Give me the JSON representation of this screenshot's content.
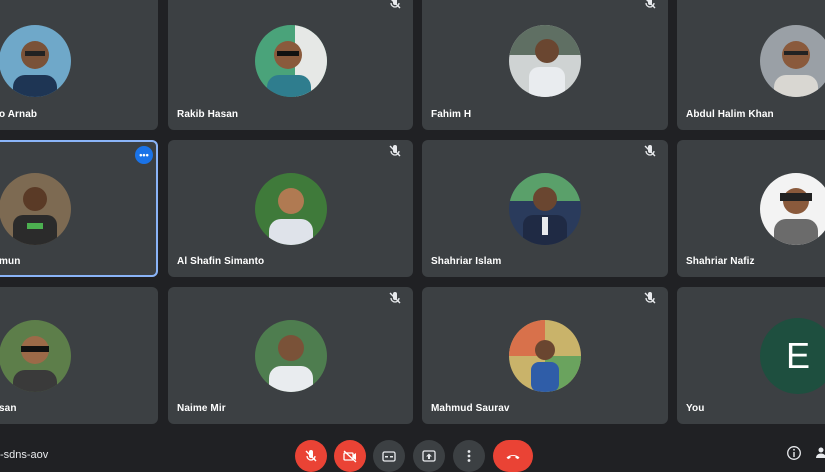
{
  "participants": {
    "row1": [
      {
        "name": "o Arnab",
        "muted": false
      },
      {
        "name": "Rakib Hasan",
        "muted": true
      },
      {
        "name": "Fahim H",
        "muted": true
      },
      {
        "name": "Abdul Halim Khan",
        "muted": false
      }
    ],
    "row2": [
      {
        "name": "mun",
        "muted": false,
        "pinned_more": "•••"
      },
      {
        "name": "Al Shafin Simanto",
        "muted": true
      },
      {
        "name": "Shahriar Islam",
        "muted": true
      },
      {
        "name": "Shahriar Nafiz",
        "muted": false
      }
    ],
    "row3": [
      {
        "name": "san",
        "muted": false
      },
      {
        "name": "Naime Mir",
        "muted": true
      },
      {
        "name": "Mahmud Saurav",
        "muted": true
      },
      {
        "name": "You",
        "muted": false,
        "initial": "E"
      }
    ]
  },
  "bottombar": {
    "meeting_code": "-sdns-aov"
  },
  "colors": {
    "background": "#202124",
    "tile": "#3c4043",
    "active_border": "#8ab4f8",
    "danger": "#ea4335",
    "you_avatar": "#1e4f3f"
  }
}
